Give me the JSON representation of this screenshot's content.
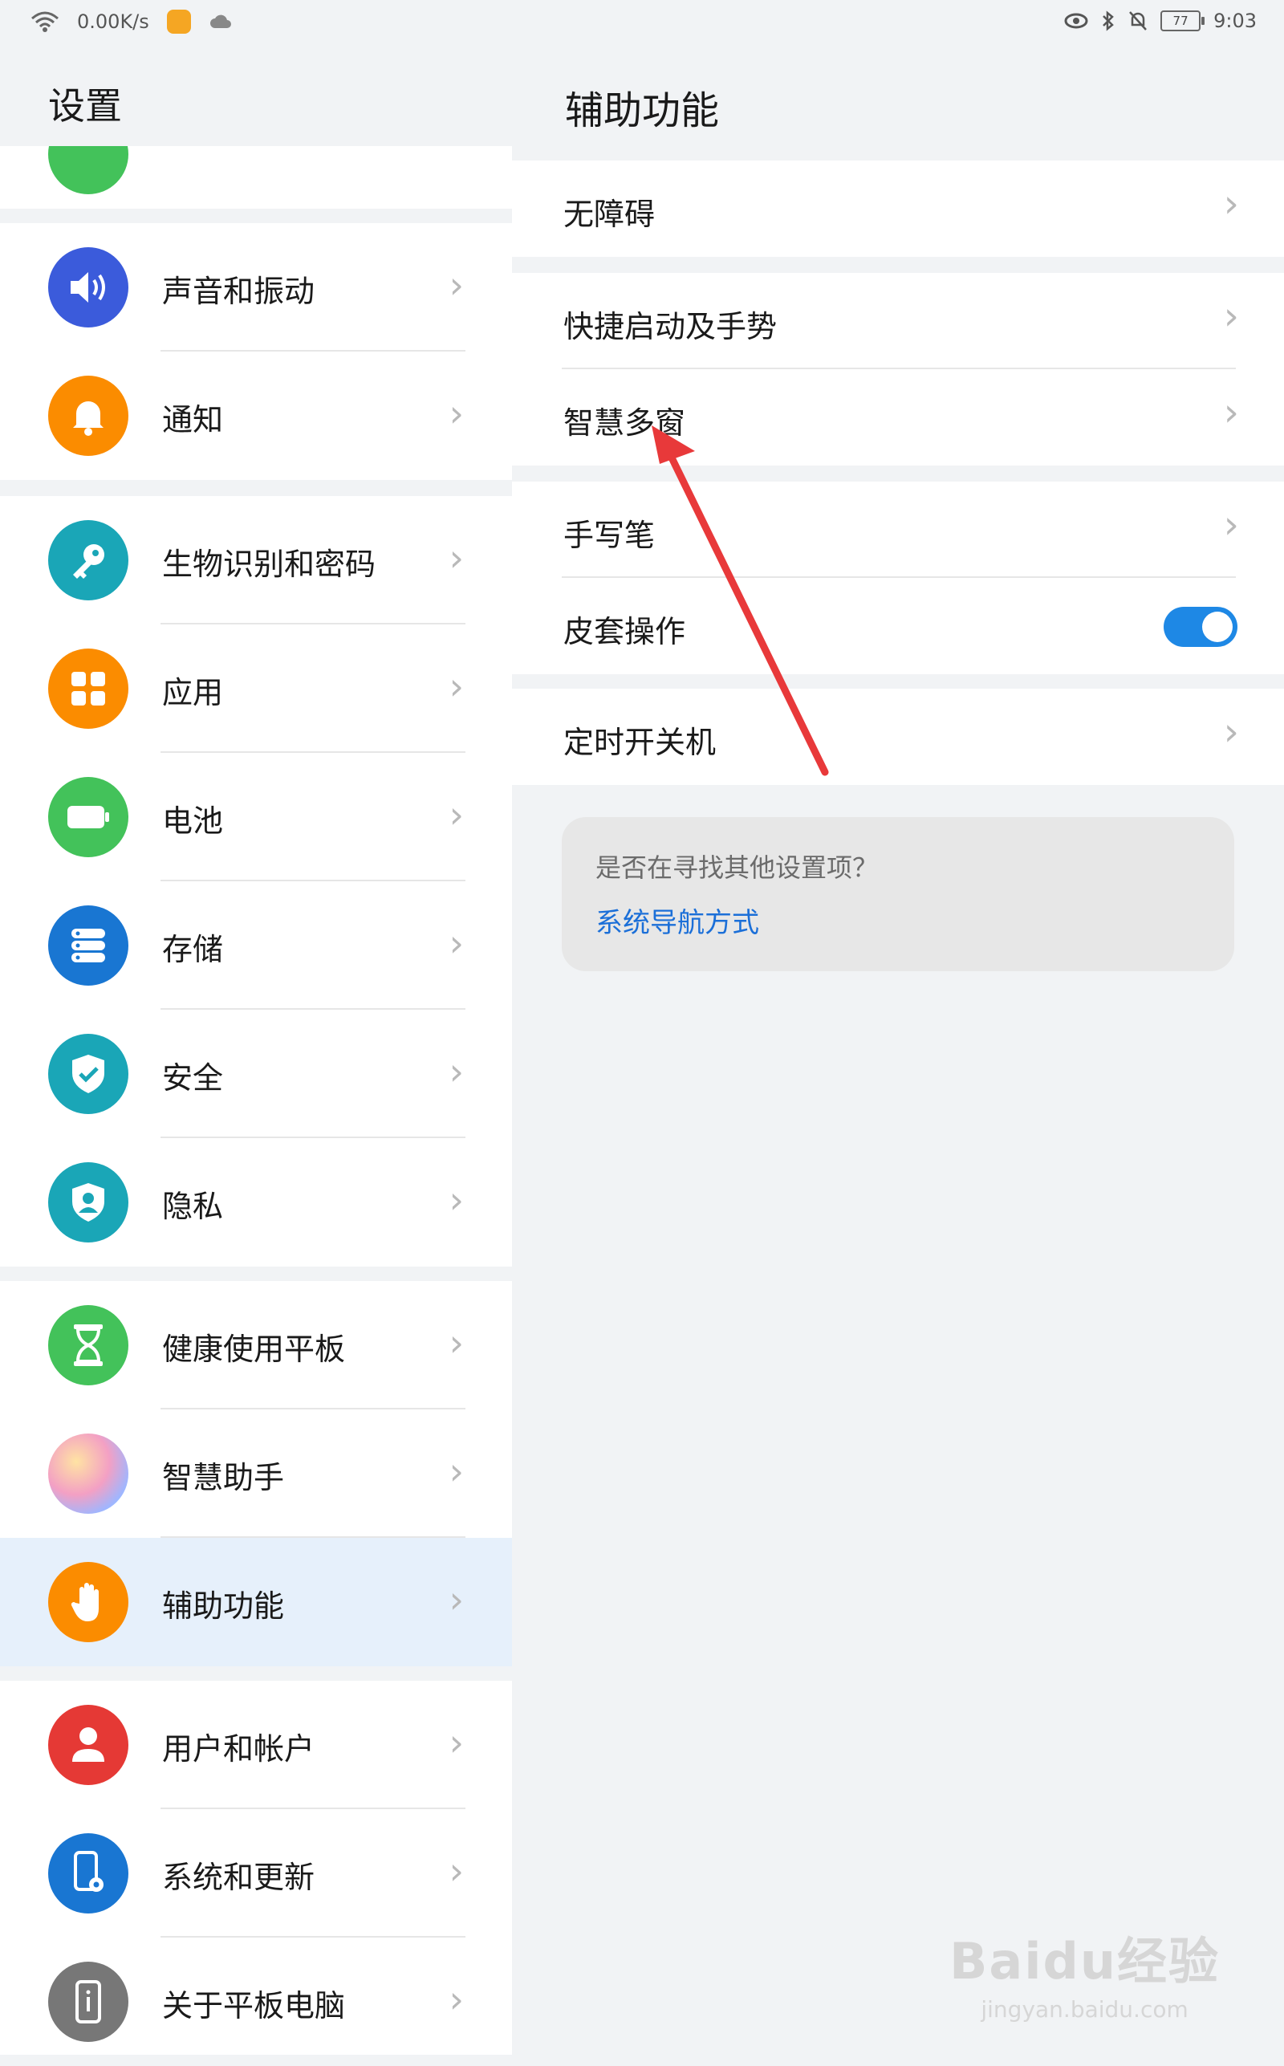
{
  "status_bar": {
    "speed": "0.00K/s",
    "battery": "77",
    "time": "9:03"
  },
  "left_pane": {
    "title": "设置",
    "groups": [
      {
        "items": [
          {
            "label": "声音和振动",
            "icon": "speaker-icon",
            "color": "#3b5bdb"
          },
          {
            "label": "通知",
            "icon": "bell-icon",
            "color": "#fb8c00"
          }
        ]
      },
      {
        "items": [
          {
            "label": "生物识别和密码",
            "icon": "key-icon",
            "color": "#1aa6b7"
          },
          {
            "label": "应用",
            "icon": "apps-grid-icon",
            "color": "#fb8c00"
          },
          {
            "label": "电池",
            "icon": "battery-icon",
            "color": "#43c25a"
          },
          {
            "label": "存储",
            "icon": "storage-icon",
            "color": "#1976d2"
          },
          {
            "label": "安全",
            "icon": "shield-check-icon",
            "color": "#1aa6b7"
          },
          {
            "label": "隐私",
            "icon": "privacy-icon",
            "color": "#1aa6b7"
          }
        ]
      },
      {
        "items": [
          {
            "label": "健康使用平板",
            "icon": "hourglass-icon",
            "color": "#43c25a"
          },
          {
            "label": "智慧助手",
            "icon": "assistant-icon",
            "color": "#f0a3c4"
          },
          {
            "label": "辅助功能",
            "icon": "hand-icon",
            "color": "#fb8c00",
            "selected": true
          }
        ]
      },
      {
        "items": [
          {
            "label": "用户和帐户",
            "icon": "user-icon",
            "color": "#e53935"
          },
          {
            "label": "系统和更新",
            "icon": "system-update-icon",
            "color": "#1976d2"
          },
          {
            "label": "关于平板电脑",
            "icon": "info-device-icon",
            "color": "#777777"
          }
        ]
      }
    ]
  },
  "right_pane": {
    "title": "辅助功能",
    "groups": [
      {
        "items": [
          {
            "label": "无障碍"
          }
        ]
      },
      {
        "items": [
          {
            "label": "快捷启动及手势"
          },
          {
            "label": "智慧多窗"
          }
        ]
      },
      {
        "items": [
          {
            "label": "手写笔"
          },
          {
            "label": "皮套操作",
            "toggle": true
          }
        ]
      },
      {
        "items": [
          {
            "label": "定时开关机"
          }
        ]
      }
    ],
    "hint": {
      "question": "是否在寻找其他设置项？",
      "link": "系统导航方式"
    }
  },
  "watermark": {
    "brand": "Baidu经验",
    "url": "jingyan.baidu.com"
  },
  "colors": {
    "accent": "#1e88e5",
    "arrow": "#e8393a",
    "selected_bg": "#e6f0fb"
  }
}
